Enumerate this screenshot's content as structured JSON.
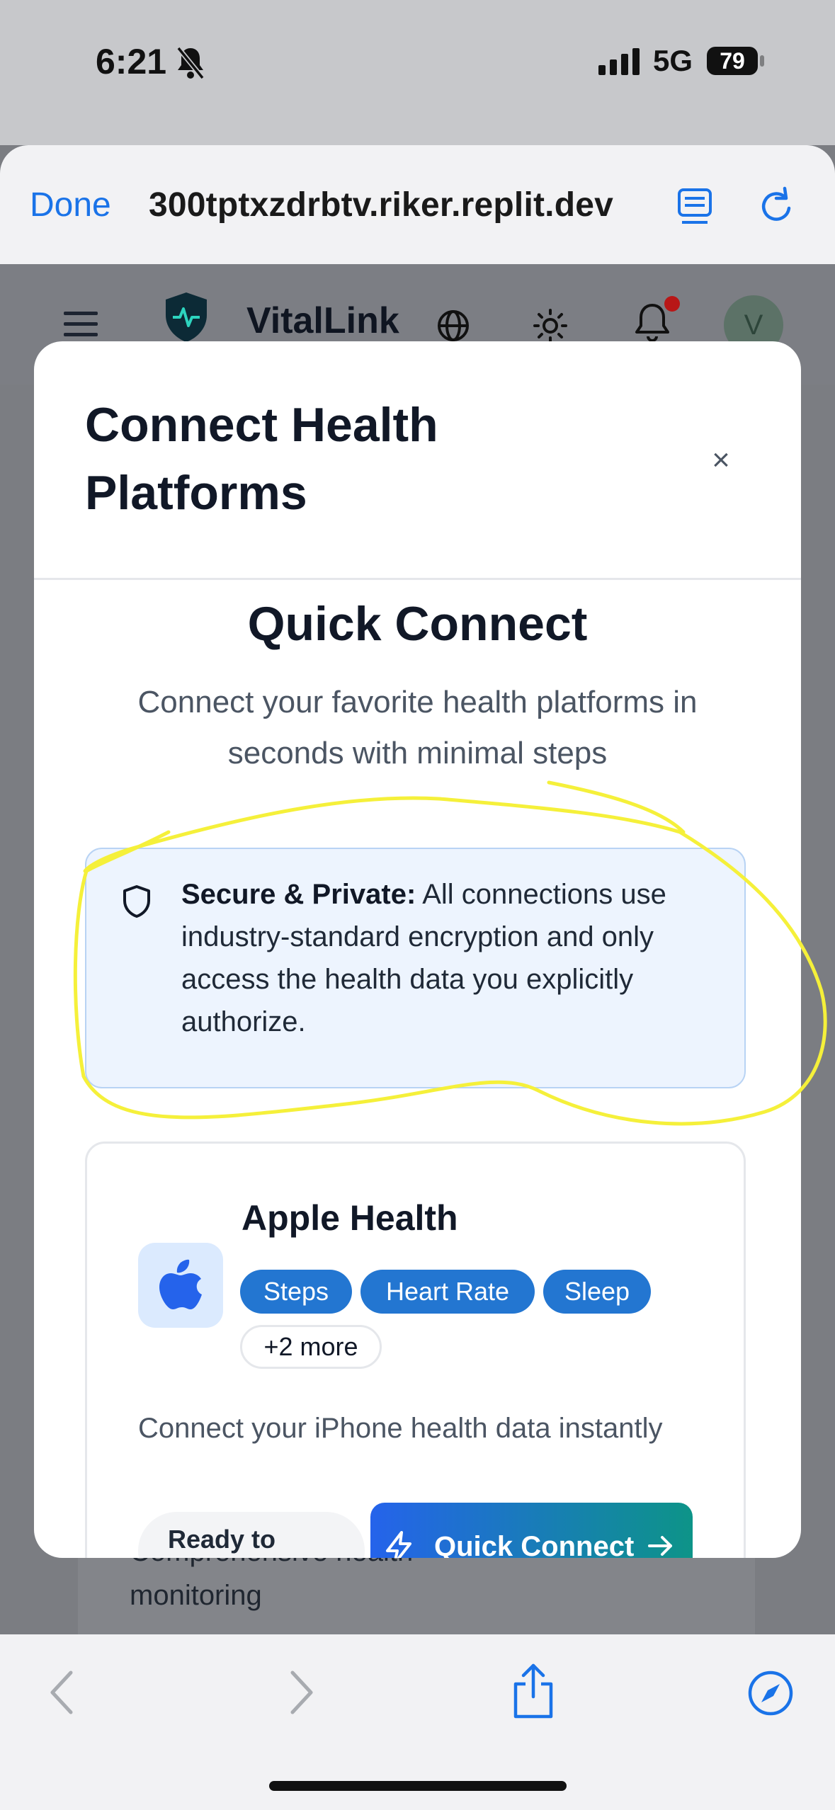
{
  "status_bar": {
    "time": "6:21",
    "network": "5G",
    "battery": "79"
  },
  "browser": {
    "done_label": "Done",
    "url": "300tptxzdrbtv.riker.replit.dev"
  },
  "app_header": {
    "brand": "VitalLink",
    "avatar_initial": "V"
  },
  "background_page": {
    "text_line1": "Comprehensive health",
    "text_line2": "monitoring"
  },
  "modal": {
    "title": "Connect Health Platforms",
    "close_label": "×",
    "quick_connect_title": "Quick Connect",
    "quick_connect_subtitle": "Connect your favorite health platforms in seconds with minimal steps",
    "secure_title": "Secure & Private:",
    "secure_text": " All connections use industry-standard encryption and only access the health data you explicitly authorize."
  },
  "platform": {
    "name": "Apple Health",
    "chips": [
      "Steps",
      "Heart Rate",
      "Sleep"
    ],
    "more_chip": "+2 more",
    "description": "Connect your iPhone health data instantly",
    "status": "Ready to",
    "button_label": "Quick Connect"
  },
  "colors": {
    "accent": "#1a73e8",
    "chip_blue": "#2376d1",
    "annotation": "#f5f03a"
  }
}
